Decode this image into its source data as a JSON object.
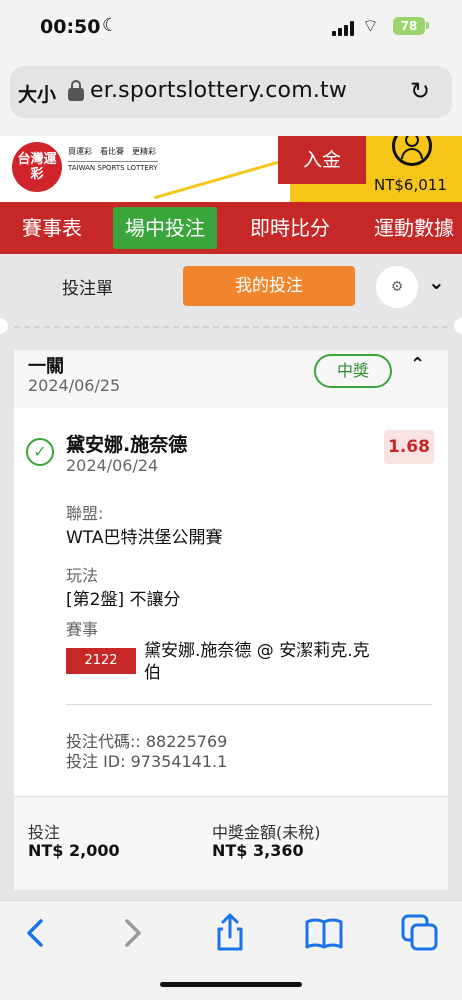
{
  "status": {
    "time": "00:50",
    "battery": "78"
  },
  "browser": {
    "text_size_label": "大小",
    "url": "er.sportslottery.com.tw"
  },
  "site": {
    "logo_text": "台灣運彩",
    "tagline": "買運彩　看比賽　更精彩",
    "subtitle": "TAIWAN SPORTS LOTTERY",
    "deposit_label": "入金",
    "balance": "NT$6,011"
  },
  "nav": {
    "items": [
      "賽事表",
      "場中投注",
      "即時比分",
      "運動數據"
    ],
    "active_index": 1
  },
  "tabs": {
    "slip": "投注單",
    "my_bets": "我的投注"
  },
  "bet": {
    "type": "一關",
    "date": "2024/06/25",
    "status": "中獎",
    "selection": "黛安娜.施奈德",
    "selection_date": "2024/06/24",
    "odds": "1.68",
    "league_label": "聯盟:",
    "league": "WTA巴特洪堡公開賽",
    "market_label": "玩法",
    "market": "[第2盤] 不讓分",
    "event_label": "賽事",
    "event_id": "2122",
    "event_name": "黛安娜.施奈德 @ 安潔莉克.克伯",
    "bet_code": "投注代碼:: 88225769",
    "bet_id": "投注 ID: 97354141.1",
    "stake_label": "投注",
    "stake": "NT$ 2,000",
    "payout_label": "中獎金額(未稅)",
    "payout": "NT$ 3,360"
  },
  "colors": {
    "brand_red": "#c62828",
    "active_green": "#3aa53a",
    "accent_orange": "#f0852d",
    "yellow": "#f5c518"
  }
}
